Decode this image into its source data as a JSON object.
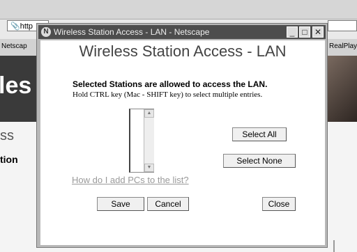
{
  "browser": {
    "address_text": "http",
    "link_left": "Netscap",
    "link_right": "RealPlaye",
    "hero_text": "les",
    "side_heading": "ss",
    "side_label": "tion"
  },
  "dialog": {
    "window_title": "Wireless Station Access - LAN - Netscape",
    "heading": "Wireless Station Access - LAN",
    "instruction_bold": "Selected Stations are allowed to access the LAN.",
    "instruction_hint": "Hold CTRL key (Mac - SHIFT key) to select multiple entries.",
    "select_all_label": "Select All",
    "select_none_label": "Select None",
    "help_link": "How do I add PCs to the list?",
    "save_label": "Save",
    "cancel_label": "Cancel",
    "close_label": "Close"
  }
}
